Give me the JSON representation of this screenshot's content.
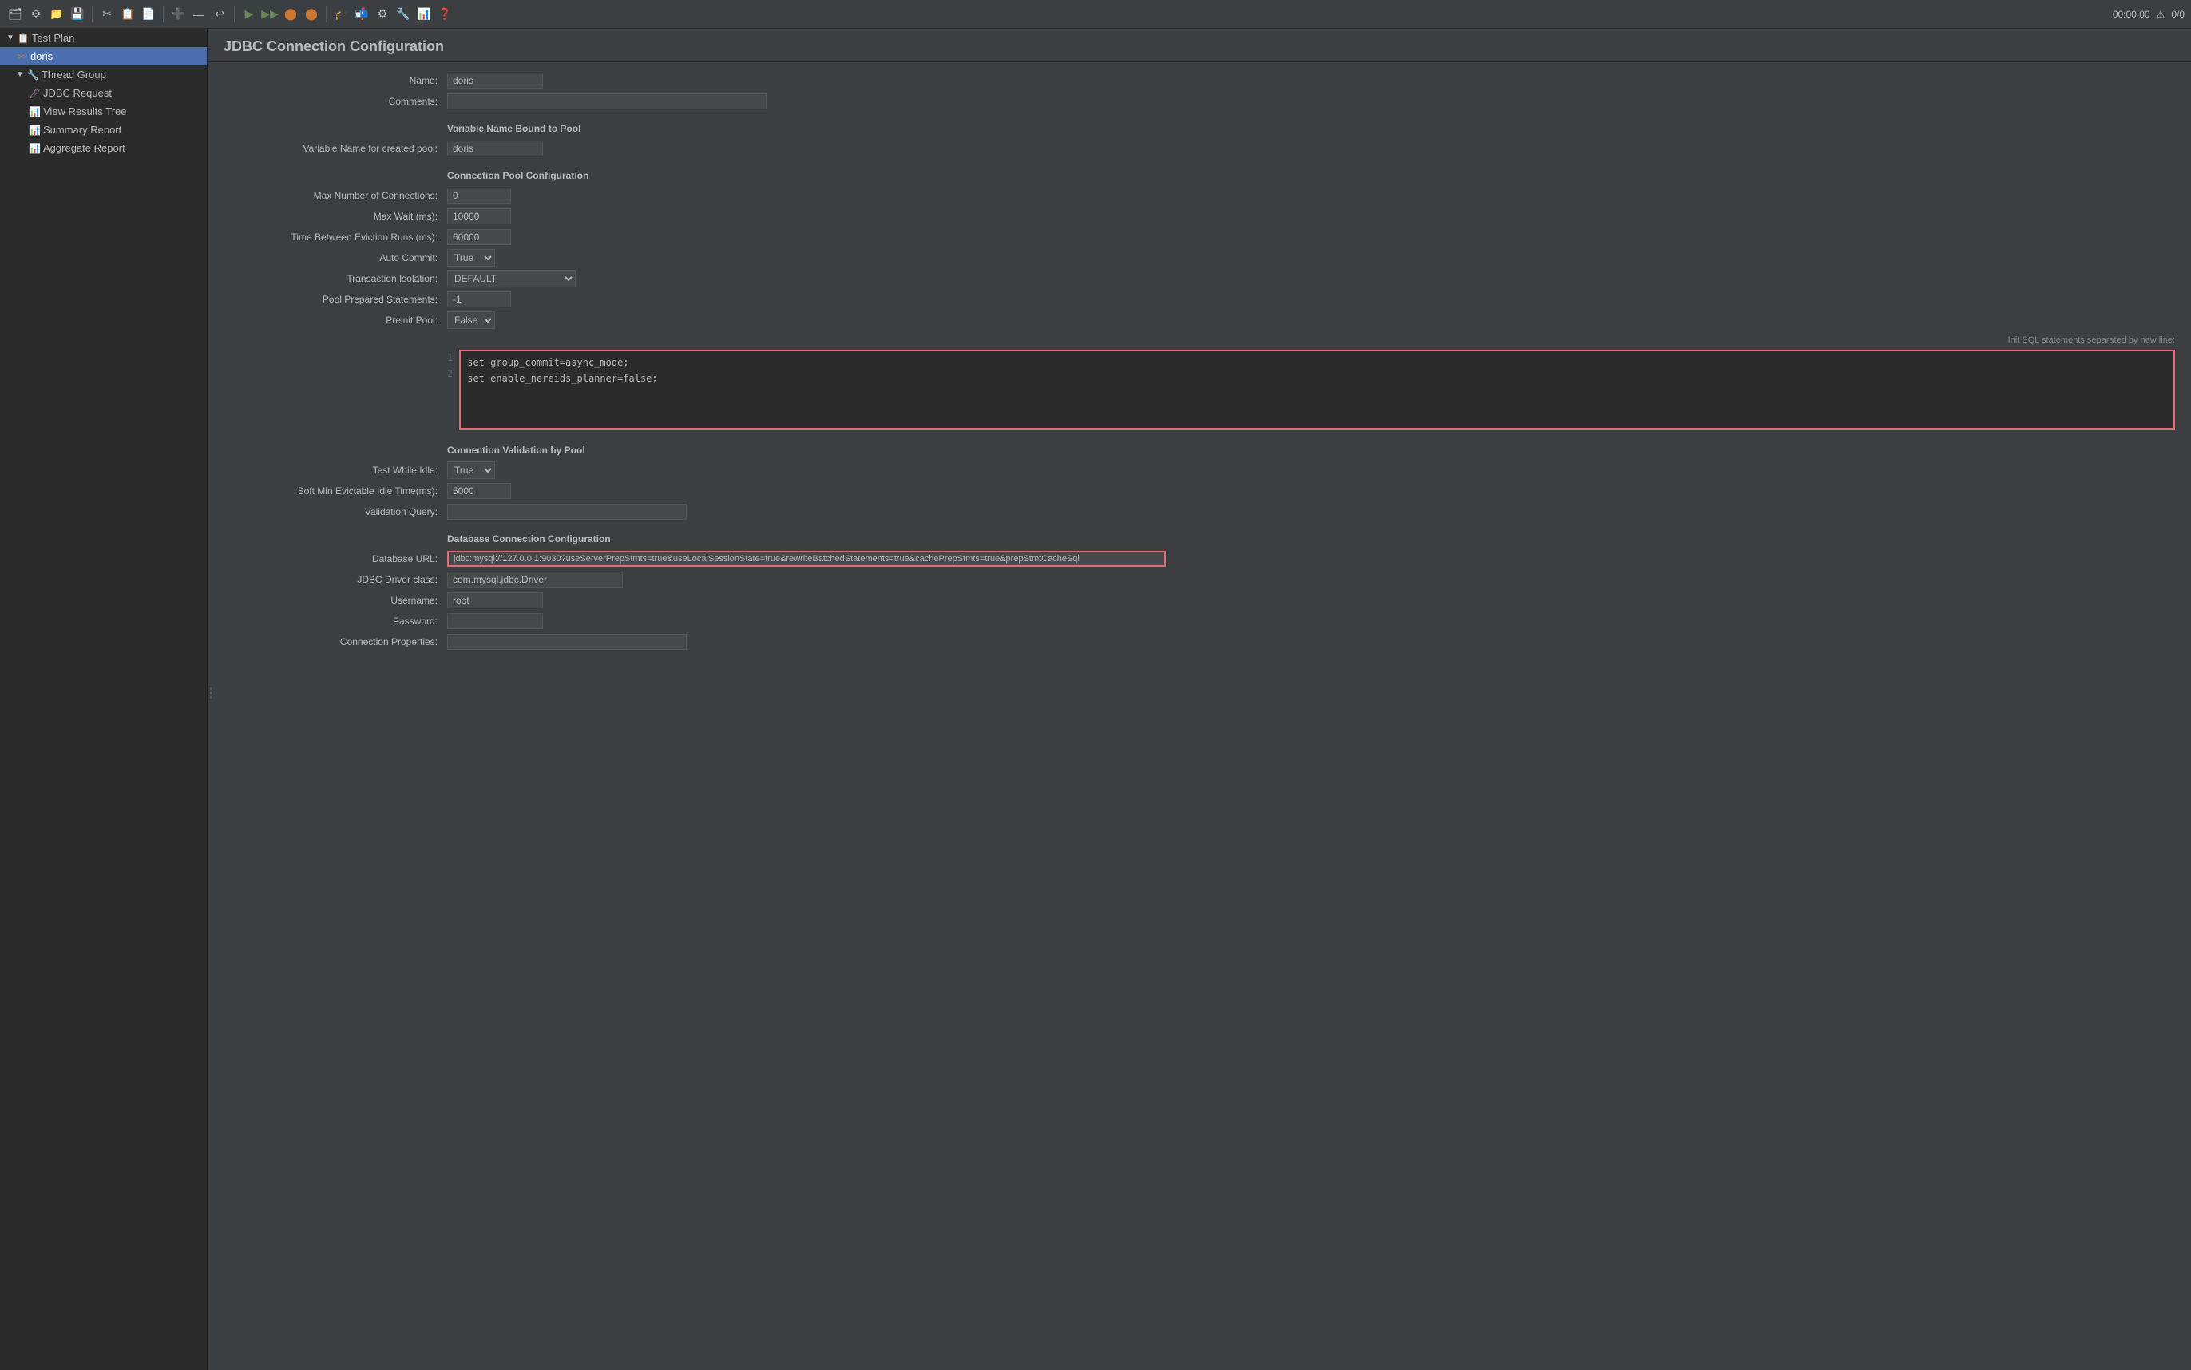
{
  "toolbar": {
    "icons": [
      "🗂",
      "🔧",
      "📁",
      "💾",
      "✂",
      "📋",
      "📄",
      "➕",
      "—",
      "↩",
      "▶",
      "▶▶",
      "⬤",
      "⬤",
      "🎓",
      "📬",
      "⚙",
      "🔧",
      "📊",
      "❓"
    ],
    "time": "00:00:00",
    "warning_icon": "⚠",
    "status": "0/0"
  },
  "sidebar": {
    "items": [
      {
        "id": "test-plan",
        "label": "Test Plan",
        "indent": 0,
        "icon": "📋",
        "expanded": true
      },
      {
        "id": "doris",
        "label": "doris",
        "indent": 1,
        "icon": "✂",
        "selected": true
      },
      {
        "id": "thread-group",
        "label": "Thread Group",
        "indent": 1,
        "icon": "🔧",
        "expanded": true
      },
      {
        "id": "jdbc-request",
        "label": "JDBC Request",
        "indent": 2,
        "icon": "🖊"
      },
      {
        "id": "view-results-tree",
        "label": "View Results Tree",
        "indent": 2,
        "icon": "📊"
      },
      {
        "id": "summary-report",
        "label": "Summary Report",
        "indent": 2,
        "icon": "📊"
      },
      {
        "id": "aggregate-report",
        "label": "Aggregate Report",
        "indent": 2,
        "icon": "📊"
      }
    ]
  },
  "panel": {
    "title": "JDBC Connection Configuration",
    "name_label": "Name:",
    "name_value": "doris",
    "comments_label": "Comments:",
    "comments_value": ""
  },
  "variable_name_section": {
    "heading": "Variable Name Bound to Pool",
    "pool_name_label": "Variable Name for created pool:",
    "pool_name_value": "doris"
  },
  "connection_pool_section": {
    "heading": "Connection Pool Configuration",
    "max_connections_label": "Max Number of Connections:",
    "max_connections_value": "0",
    "max_wait_label": "Max Wait (ms):",
    "max_wait_value": "10000",
    "time_eviction_label": "Time Between Eviction Runs (ms):",
    "time_eviction_value": "60000",
    "auto_commit_label": "Auto Commit:",
    "auto_commit_value": "True",
    "transaction_isolation_label": "Transaction Isolation:",
    "transaction_isolation_value": "DEFAULT",
    "pool_prepared_label": "Pool Prepared Statements:",
    "pool_prepared_value": "-1",
    "preinit_pool_label": "Preinit Pool:",
    "preinit_pool_value": "False"
  },
  "init_sql": {
    "label": "Init SQL statements separated by new line:",
    "line1": "set group_commit=async_mode;",
    "line2": "set enable_nereids_planner=false;"
  },
  "connection_validation_section": {
    "heading": "Connection Validation by Pool",
    "test_while_idle_label": "Test While Idle:",
    "test_while_idle_value": "True",
    "soft_min_label": "Soft Min Evictable Idle Time(ms):",
    "soft_min_value": "5000",
    "validation_query_label": "Validation Query:",
    "validation_query_value": ""
  },
  "database_connection_section": {
    "heading": "Database Connection Configuration",
    "database_url_label": "Database URL:",
    "database_url_value": "jdbc:mysql://127.0.0.1:9030?useServerPrepStmts=true&useLocalSessionState=true&rewriteBatchedStatements=true&cachePrepStmts=true&prepStmtCacheSql",
    "jdbc_driver_label": "JDBC Driver class:",
    "jdbc_driver_value": "com.mysql.jdbc.Driver",
    "username_label": "Username:",
    "username_value": "root",
    "password_label": "Password:",
    "password_value": "",
    "connection_props_label": "Connection Properties:",
    "connection_props_value": ""
  }
}
